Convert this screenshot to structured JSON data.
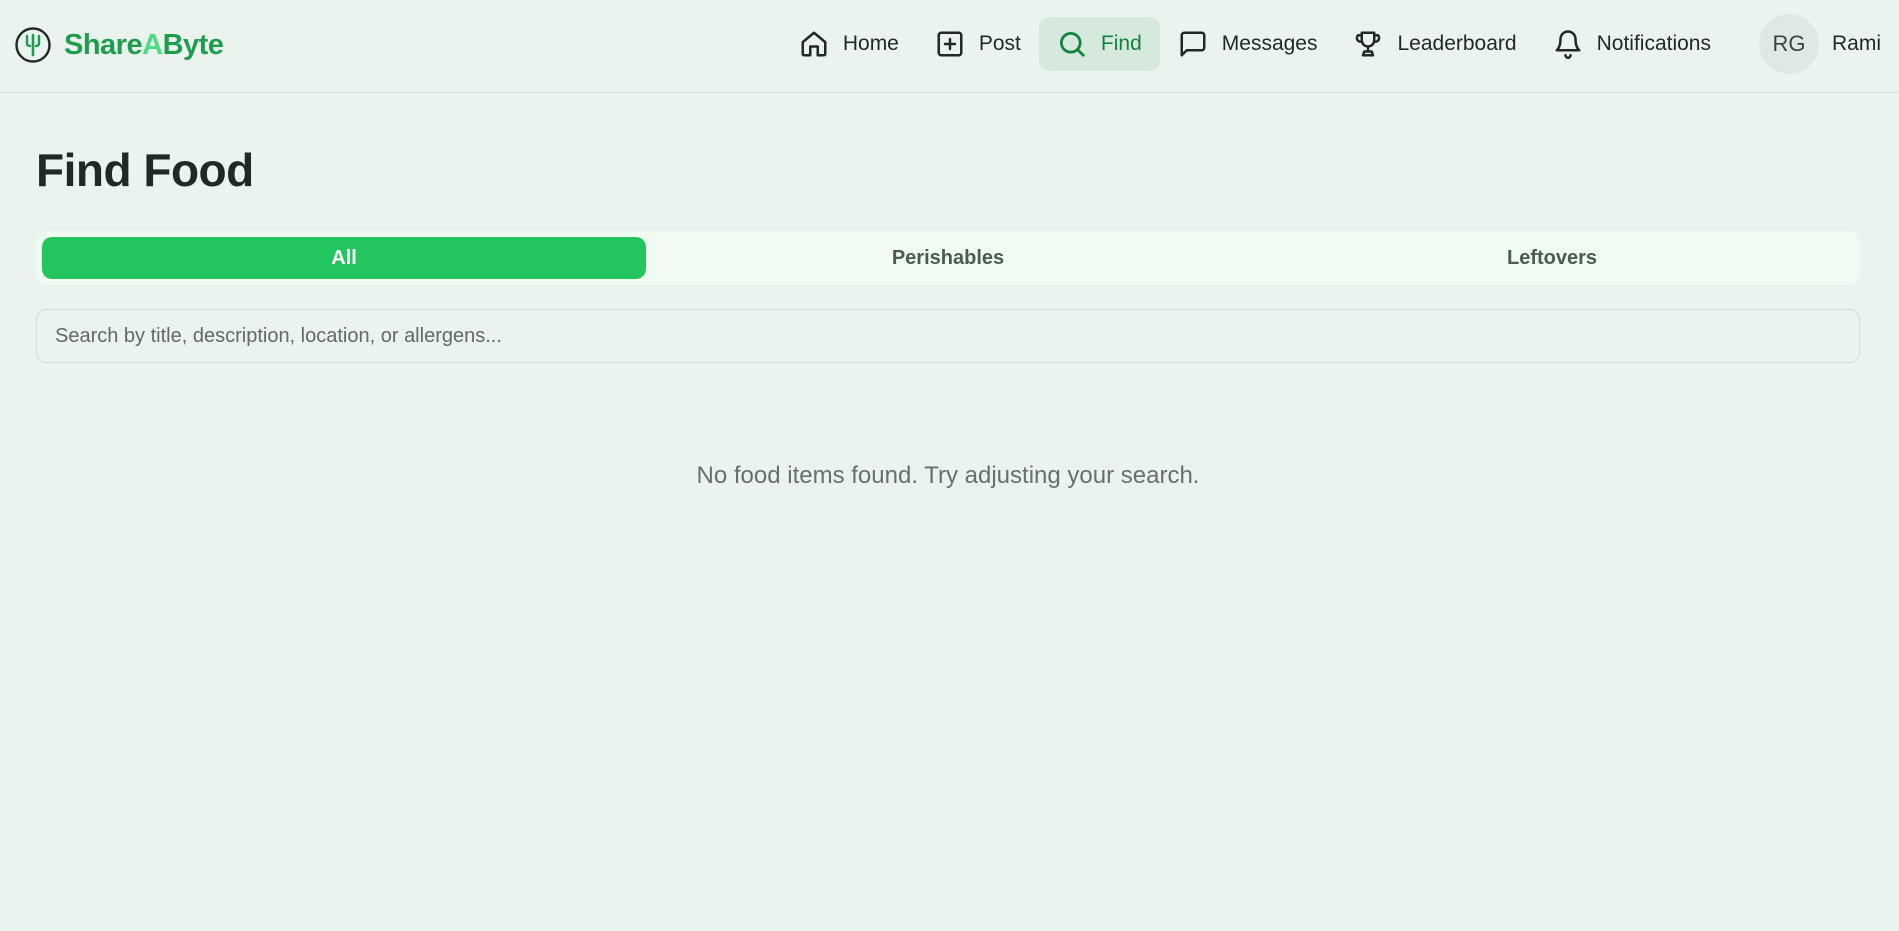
{
  "brand": {
    "name_part1": "Share",
    "name_part2": "A",
    "name_part3": "Byte",
    "icon": "utensils-logo-icon",
    "color": "#1f9d4f",
    "accent": "#4ade80"
  },
  "nav": {
    "items": [
      {
        "label": "Home",
        "icon": "home-icon"
      },
      {
        "label": "Post",
        "icon": "plus-square-icon"
      },
      {
        "label": "Find",
        "icon": "search-icon",
        "active": true
      },
      {
        "label": "Messages",
        "icon": "message-icon"
      },
      {
        "label": "Leaderboard",
        "icon": "trophy-icon"
      },
      {
        "label": "Notifications",
        "icon": "bell-icon"
      }
    ],
    "user": {
      "initials": "RG",
      "name": "Rami"
    }
  },
  "page": {
    "title": "Find Food",
    "tabs": [
      {
        "label": "All",
        "active": true
      },
      {
        "label": "Perishables"
      },
      {
        "label": "Leftovers"
      }
    ],
    "search": {
      "placeholder": "Search by title, description, location, or allergens...",
      "value": ""
    },
    "empty_message": "No food items found. Try adjusting your search."
  },
  "colors": {
    "primary": "#22c55e",
    "background": "#eaf3ee",
    "active_nav_bg": "#d5eadc",
    "active_nav_text": "#16803d"
  }
}
